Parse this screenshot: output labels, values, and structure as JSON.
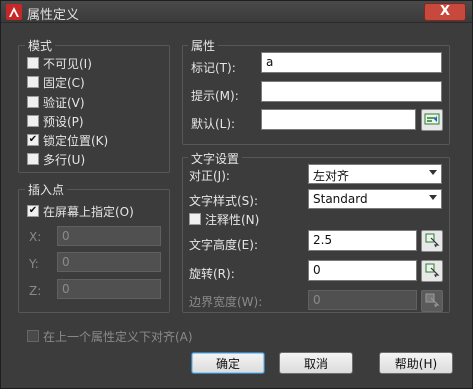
{
  "window": {
    "title": "属性定义",
    "close_glyph": "X"
  },
  "mode": {
    "title": "模式",
    "options": [
      {
        "label": "不可见(I)",
        "checked": false
      },
      {
        "label": "固定(C)",
        "checked": false
      },
      {
        "label": "验证(V)",
        "checked": false
      },
      {
        "label": "预设(P)",
        "checked": false
      },
      {
        "label": "锁定位置(K)",
        "checked": true
      },
      {
        "label": "多行(U)",
        "checked": false
      }
    ]
  },
  "insert": {
    "title": "插入点",
    "on_screen_label": "在屏幕上指定(O)",
    "x_label": "X:",
    "x_value": "0",
    "y_label": "Y:",
    "y_value": "0",
    "z_label": "Z:",
    "z_value": "0"
  },
  "attribute": {
    "title": "属性",
    "tag_label": "标记(T):",
    "tag_value": "a",
    "prompt_label": "提示(M):",
    "prompt_value": "",
    "default_label": "默认(L):",
    "default_value": ""
  },
  "text": {
    "title": "文字设置",
    "justify_label": "对正(J):",
    "justify_value": "左对齐",
    "style_label": "文字样式(S):",
    "style_value": "Standard",
    "annotative_label": "注释性(N)",
    "height_label": "文字高度(E):",
    "height_value": "2.5",
    "rotation_label": "旋转(R):",
    "rotation_value": "0",
    "boundary_label": "边界宽度(W):",
    "boundary_value": "0"
  },
  "align_below_label": "在上一个属性定义下对齐(A)",
  "buttons": {
    "ok": "确定",
    "cancel": "取消",
    "help": "帮助(H)"
  }
}
